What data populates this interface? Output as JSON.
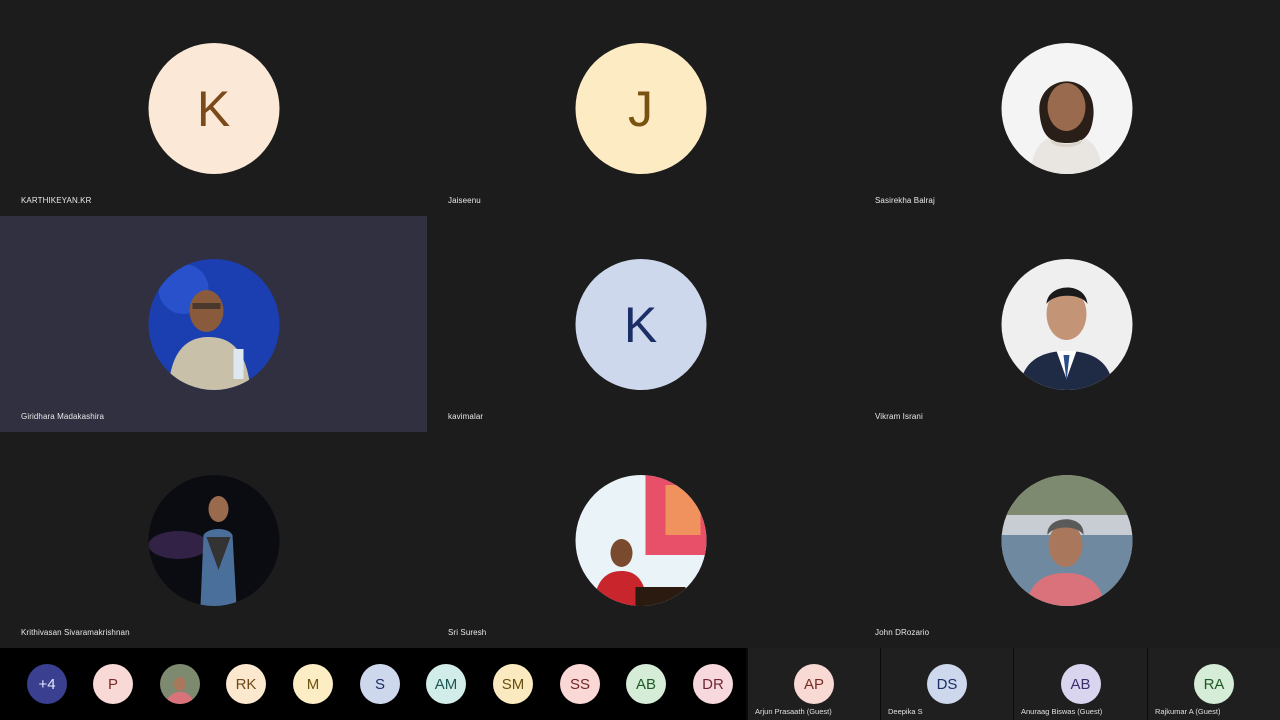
{
  "tiles": [
    {
      "name": "KARTHIKEYAN.KR",
      "initial": "K",
      "bg": "#fbe8d7",
      "fg": "#7a4a1a",
      "photo": false
    },
    {
      "name": "Jaiseenu",
      "initial": "J",
      "bg": "#fcebc3",
      "fg": "#7a5210",
      "photo": false
    },
    {
      "name": "Sasirekha Balraj",
      "initial": "",
      "photo": true,
      "photo_id": "photo-woman-white"
    },
    {
      "name": "Giridhara Madakashira",
      "initial": "",
      "photo": true,
      "photo_id": "photo-man-stage-blue",
      "active": true
    },
    {
      "name": "kavimalar",
      "initial": "K",
      "bg": "#cdd8ec",
      "fg": "#1b2f66",
      "photo": false
    },
    {
      "name": "Vikram Israni",
      "initial": "",
      "photo": true,
      "photo_id": "photo-man-suit"
    },
    {
      "name": "Krithivasan Sivaramakrishnan",
      "initial": "",
      "photo": true,
      "photo_id": "photo-man-dark-stage"
    },
    {
      "name": "Sri Suresh",
      "initial": "",
      "photo": true,
      "photo_id": "photo-woman-podium"
    },
    {
      "name": "John DRozario",
      "initial": "",
      "photo": true,
      "photo_id": "photo-man-pool"
    }
  ],
  "strip": [
    {
      "label": "+4",
      "bg": "#3a3f8f",
      "fg": "#e8e8ff"
    },
    {
      "label": "P",
      "bg": "#f8d9d5",
      "fg": "#7a2b25"
    },
    {
      "label": "",
      "photo": true,
      "photo_id": "photo-small-man"
    },
    {
      "label": "RK",
      "bg": "#fbe8cf",
      "fg": "#6e4a18"
    },
    {
      "label": "M",
      "bg": "#fcedc4",
      "fg": "#6d5310"
    },
    {
      "label": "S",
      "bg": "#cdd8ec",
      "fg": "#1b2f66"
    },
    {
      "label": "AM",
      "bg": "#d2ecea",
      "fg": "#1b5754"
    },
    {
      "label": "SM",
      "bg": "#fbeac0",
      "fg": "#6a4e0d"
    },
    {
      "label": "SS",
      "bg": "#f9d8d6",
      "fg": "#7a2424"
    },
    {
      "label": "AB",
      "bg": "#d5ecd6",
      "fg": "#1e5a27"
    },
    {
      "label": "DR",
      "bg": "#f7d9dd",
      "fg": "#702636"
    }
  ],
  "right_tiles": [
    {
      "label": "AP",
      "name": "Arjun Prasaath (Guest)",
      "bg": "#f8d9d3",
      "fg": "#7a2b25"
    },
    {
      "label": "DS",
      "name": "Deepika S",
      "bg": "#cdd8ec",
      "fg": "#1b2f66"
    },
    {
      "label": "AB",
      "name": "Anuraag Biswas (Guest)",
      "bg": "#dad5ee",
      "fg": "#3b2f6e"
    },
    {
      "label": "RA",
      "name": "Rajkumar A (Guest)",
      "bg": "#d5ecd6",
      "fg": "#1e5a27"
    }
  ]
}
